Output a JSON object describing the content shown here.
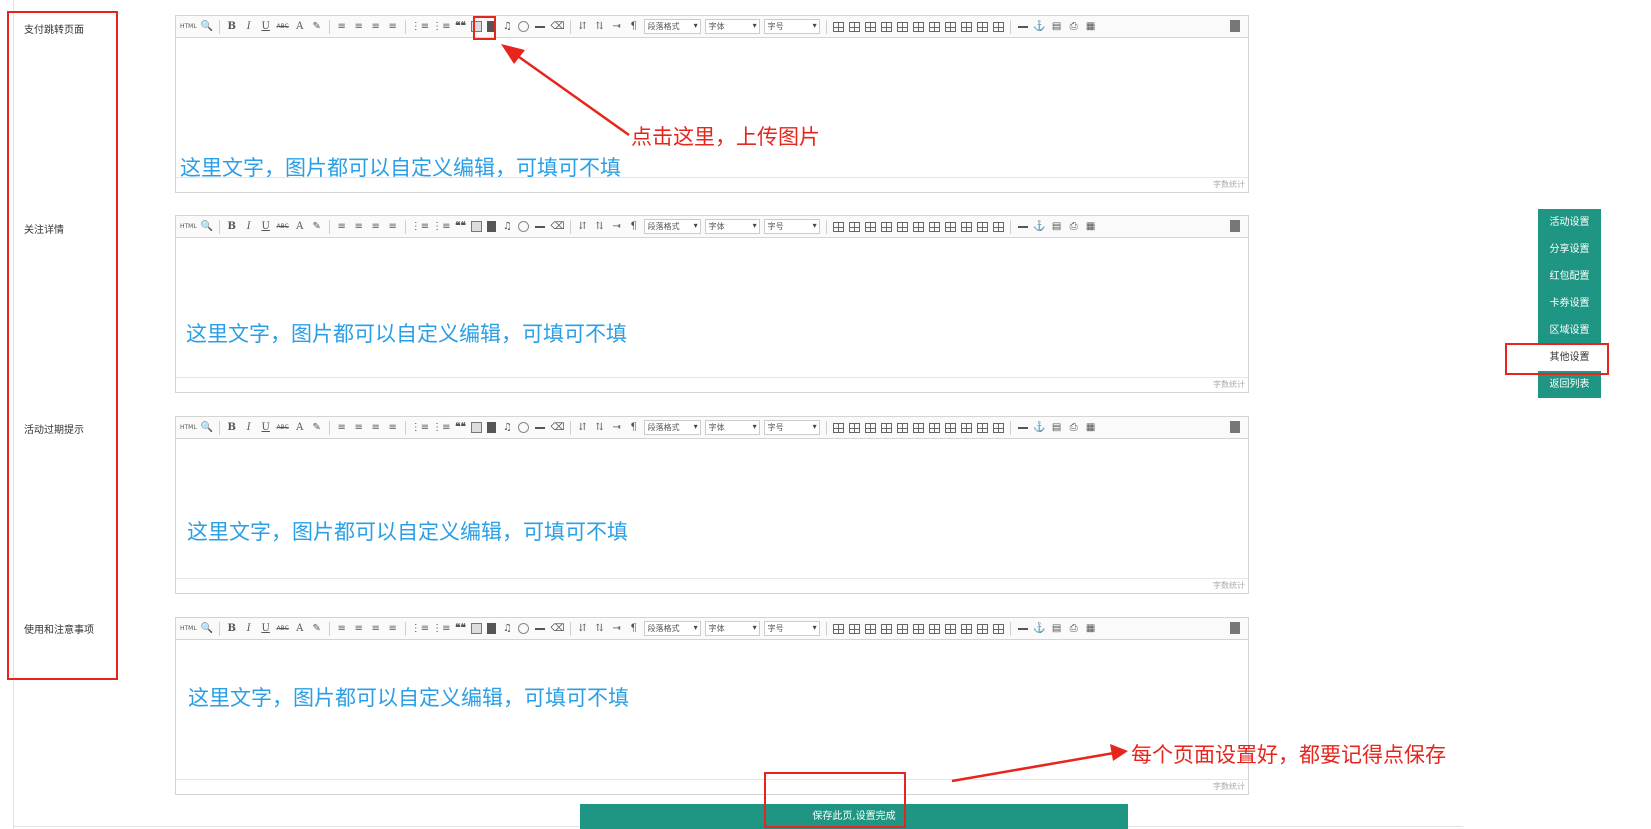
{
  "sections": [
    {
      "label": "支付跳转页面",
      "editor_text": "这里文字，图片都可以自定义编辑，可填可不填"
    },
    {
      "label": "关注详情",
      "editor_text": "这里文字，图片都可以自定义编辑，可填可不填"
    },
    {
      "label": "活动过期提示",
      "editor_text": "这里文字，图片都可以自定义编辑，可填可不填"
    },
    {
      "label": "使用和注意事项",
      "editor_text": "这里文字，图片都可以自定义编辑，可填可不填"
    }
  ],
  "toolbar": {
    "html_label": "HTML",
    "bold": "B",
    "italic": "I",
    "underline": "U",
    "strike": "ABC",
    "font_color": "A",
    "quote": "❝❝",
    "paragraph_select": "段落格式",
    "font_select": "字体",
    "size_select": "字号"
  },
  "word_count_label": "字数统计",
  "annotations": {
    "upload_hint": "点击这里，上传图片",
    "save_hint": "每个页面设置好，都要记得点保存"
  },
  "save_button": "保存此页,设置完成",
  "side_menu": [
    {
      "label": "活动设置",
      "active": false
    },
    {
      "label": "分享设置",
      "active": false
    },
    {
      "label": "红包配置",
      "active": false
    },
    {
      "label": "卡券设置",
      "active": false
    },
    {
      "label": "区域设置",
      "active": false
    },
    {
      "label": "其他设置",
      "active": true
    },
    {
      "label": "返回列表",
      "active": false
    }
  ],
  "colors": {
    "accent": "#1f9583",
    "annotation_red": "#e8251c",
    "editor_text_blue": "#2b9fe6"
  }
}
